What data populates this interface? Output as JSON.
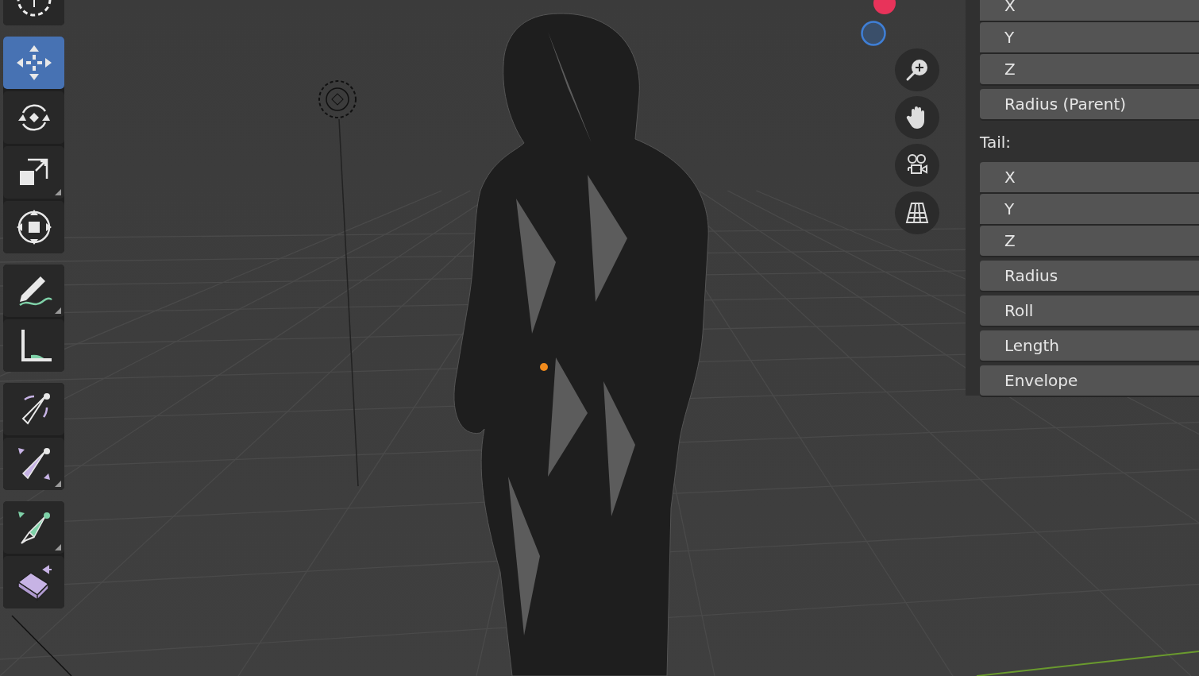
{
  "toolbar": {
    "groups": [
      {
        "tools": [
          {
            "kind": "cursor",
            "selected": false,
            "submenu": false
          }
        ]
      },
      {
        "tools": [
          {
            "kind": "move",
            "selected": true,
            "submenu": false
          },
          {
            "kind": "rotate",
            "selected": false,
            "submenu": false
          },
          {
            "kind": "scale",
            "selected": false,
            "submenu": true
          },
          {
            "kind": "transform",
            "selected": false,
            "submenu": false
          }
        ]
      },
      {
        "tools": [
          {
            "kind": "annotate",
            "selected": false,
            "submenu": true
          },
          {
            "kind": "measure",
            "selected": false,
            "submenu": false
          }
        ]
      },
      {
        "tools": [
          {
            "kind": "bone-roll",
            "selected": false,
            "submenu": false
          },
          {
            "kind": "bone-size",
            "selected": false,
            "submenu": true
          }
        ]
      },
      {
        "tools": [
          {
            "kind": "bone-extrude",
            "selected": false,
            "submenu": true
          },
          {
            "kind": "extrude",
            "selected": false,
            "submenu": false
          }
        ]
      }
    ]
  },
  "navigation": [
    {
      "kind": "zoom"
    },
    {
      "kind": "pan"
    },
    {
      "kind": "camera"
    },
    {
      "kind": "perspective"
    }
  ],
  "panel": {
    "items": [
      {
        "kind": "field",
        "label": "X",
        "grouped": true
      },
      {
        "kind": "field",
        "label": "Y",
        "grouped": true
      },
      {
        "kind": "field",
        "label": "Z",
        "grouped": false
      },
      {
        "kind": "field",
        "label": "Radius (Parent)",
        "grouped": false
      },
      {
        "kind": "heading",
        "label": "Tail:"
      },
      {
        "kind": "field",
        "label": "X",
        "grouped": true
      },
      {
        "kind": "field",
        "label": "Y",
        "grouped": true
      },
      {
        "kind": "field",
        "label": "Z",
        "grouped": false
      },
      {
        "kind": "field",
        "label": "Radius",
        "grouped": false
      },
      {
        "kind": "field",
        "label": "Roll",
        "grouped": false
      },
      {
        "kind": "field",
        "label": "Length",
        "grouped": false
      },
      {
        "kind": "field",
        "label": "Envelope",
        "grouped": false
      }
    ]
  }
}
